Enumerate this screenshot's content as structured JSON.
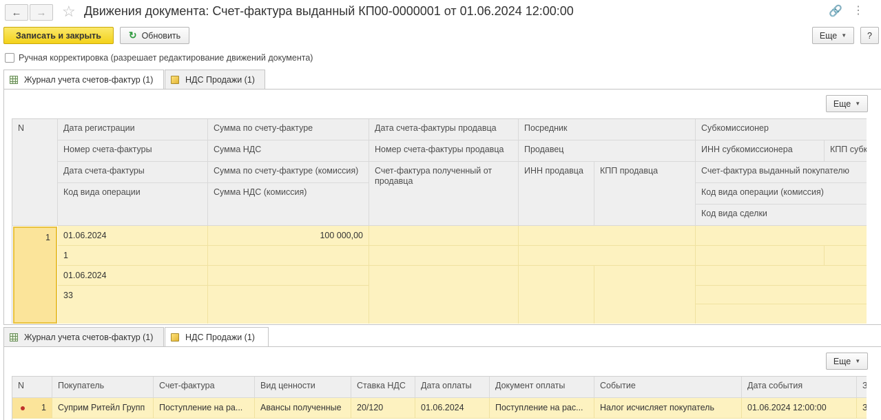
{
  "window": {
    "title": "Движения документа: Счет-фактура выданный КП00-0000001 от 01.06.2024 12:00:00"
  },
  "toolbar": {
    "save_close": "Записать и закрыть",
    "refresh": "Обновить",
    "more": "Еще",
    "help": "?"
  },
  "manual_edit_label": "Ручная корректировка (разрешает редактирование движений документа)",
  "tabs": {
    "journal": "Журнал учета счетов-фактур (1)",
    "vat_sales": "НДС Продажи (1)"
  },
  "journal_table": {
    "more": "Еще",
    "headers": {
      "n": "N",
      "reg_date": "Дата регистрации",
      "invoice_no": "Номер счета-фактуры",
      "invoice_date": "Дата счета-фактуры",
      "op_code": "Код вида операции",
      "invoice_sum": "Сумма по счету-фактуре",
      "vat_sum": "Сумма НДС",
      "invoice_sum_comm": "Сумма по счету-фактуре (комиссия)",
      "vat_sum_comm": "Сумма НДС (комиссия)",
      "seller_inv_date": "Дата счета-фактуры продавца",
      "seller_inv_no": "Номер счета-фактуры продавца",
      "received_inv": "Счет-фактура полученный от продавца",
      "intermediary": "Посредник",
      "seller": "Продавец",
      "seller_inn": "ИНН продавца",
      "seller_kpp": "КПП продавца",
      "subcommissioner": "Субкомиссионер",
      "sub_inn": "ИНН субкомиссионера",
      "sub_kpp": "КПП субк",
      "issued_inv": "Счет-фактура выданный покупателю",
      "op_code_comm": "Код вида операции (комиссия)",
      "deal_code": "Код вида сделки"
    },
    "row": {
      "n": "1",
      "reg_date": "01.06.2024",
      "invoice_no": "1",
      "invoice_date": "01.06.2024",
      "op_code": "33",
      "invoice_sum": "100 000,00"
    }
  },
  "vat_table": {
    "more": "Еще",
    "headers": {
      "n": "N",
      "buyer": "Покупатель",
      "invoice": "Счет-фактура",
      "value_type": "Вид ценности",
      "vat_rate": "Ставка НДС",
      "pay_date": "Дата оплаты",
      "pay_doc": "Документ оплаты",
      "event": "Событие",
      "event_date": "Дата события",
      "extra": "З"
    },
    "row": {
      "n": "1",
      "buyer": "Суприм Ритейл Групп",
      "invoice": "Поступление на ра...",
      "value_type": "Авансы полученные",
      "vat_rate": "20/120",
      "pay_date": "01.06.2024",
      "pay_doc": "Поступление на рас...",
      "event": "Налог исчисляет покупатель",
      "event_date": "01.06.2024 12:00:00",
      "extra": "З"
    }
  }
}
